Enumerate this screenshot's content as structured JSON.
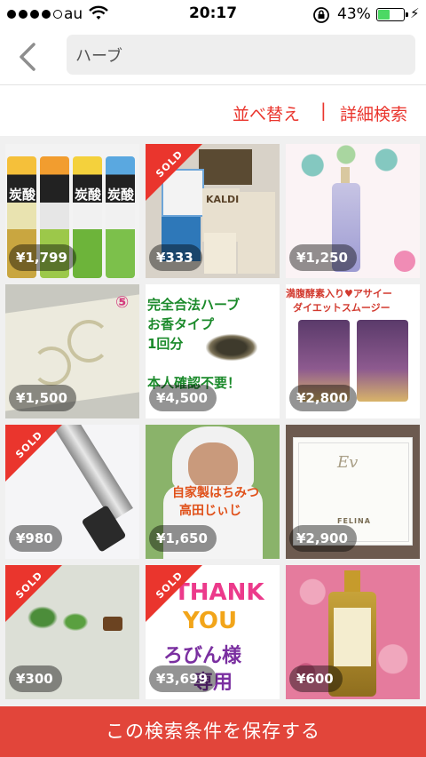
{
  "status_bar": {
    "carrier": "au",
    "time": "20:17",
    "battery_percent": "43%",
    "battery_level": 0.43
  },
  "search": {
    "query": "ハーブ"
  },
  "filters": {
    "sort_label": "並べ替え",
    "separator": "|",
    "detail_label": "詳細検索"
  },
  "items": [
    {
      "price": "¥1,799",
      "sold": false,
      "image_text": [
        "炭酸",
        "炭酸",
        "炭酸"
      ]
    },
    {
      "price": "¥333",
      "sold": true,
      "sold_label": "SOLD",
      "image_text": [
        "KALDI"
      ]
    },
    {
      "price": "¥1,250",
      "sold": false
    },
    {
      "price": "¥1,500",
      "sold": false,
      "image_text": [
        "⑤"
      ]
    },
    {
      "price": "¥4,500",
      "sold": false,
      "image_text": [
        "完全合法ハーブ",
        "お香タイプ",
        "1回分",
        "本人確認不要！"
      ]
    },
    {
      "price": "¥2,800",
      "sold": false,
      "image_text": [
        "満腹酵素入り♥アサイー",
        "ダイエットスムージー"
      ]
    },
    {
      "price": "¥980",
      "sold": true,
      "sold_label": "SOLD"
    },
    {
      "price": "¥1,650",
      "sold": false,
      "image_text": [
        "自家製はちみつ",
        "高田じぃじ"
      ]
    },
    {
      "price": "¥2,900",
      "sold": false,
      "image_text": [
        "FELINA"
      ]
    },
    {
      "price": "¥300",
      "sold": true,
      "sold_label": "SOLD"
    },
    {
      "price": "¥3,699",
      "sold": true,
      "sold_label": "SOLD",
      "image_text": [
        "THANK",
        "YOU",
        "ろびん様",
        "専用"
      ]
    },
    {
      "price": "¥600",
      "sold": false
    }
  ],
  "save_button": {
    "label": "この検索条件を保存する"
  },
  "colors": {
    "accent": "#ea352d",
    "save_button": "#e2453a"
  }
}
